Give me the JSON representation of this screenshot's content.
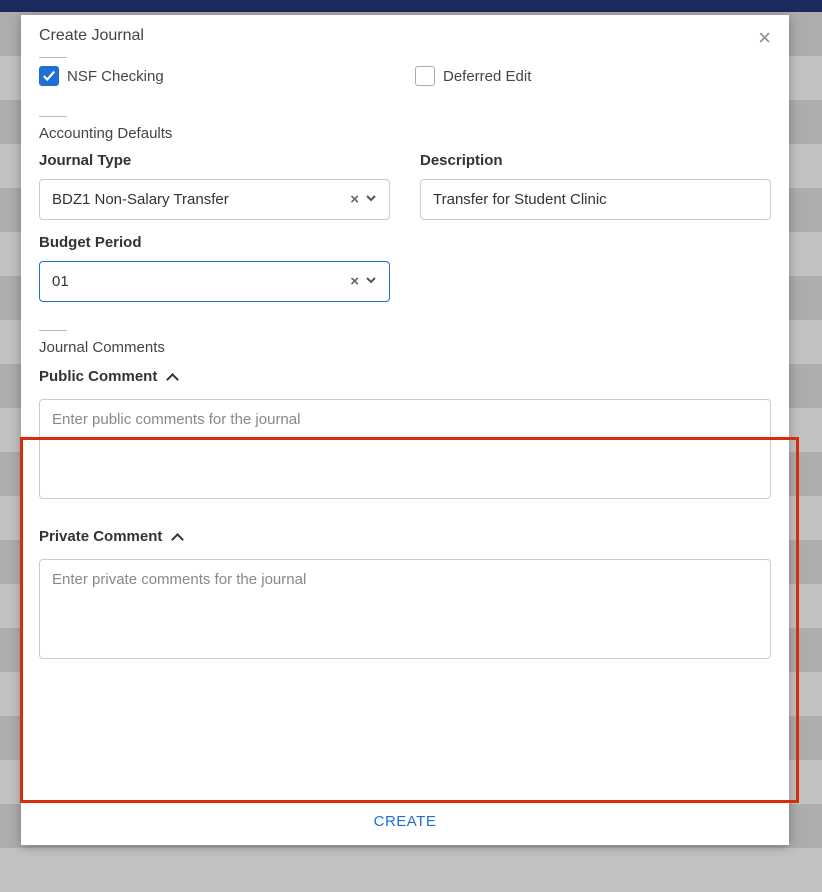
{
  "modal": {
    "title": "Create Journal",
    "checkboxes": {
      "nsf": {
        "label": "NSF Checking",
        "checked": true
      },
      "deferred": {
        "label": "Deferred Edit",
        "checked": false
      }
    },
    "accounting_defaults": {
      "heading": "Accounting Defaults",
      "journal_type": {
        "label": "Journal Type",
        "value": "BDZ1 Non-Salary Transfer"
      },
      "description": {
        "label": "Description",
        "value": "Transfer for Student Clinic"
      },
      "budget_period": {
        "label": "Budget Period",
        "value": "01"
      }
    },
    "journal_comments": {
      "heading": "Journal Comments",
      "public": {
        "label": "Public Comment",
        "placeholder": "Enter public comments for the journal",
        "value": ""
      },
      "private": {
        "label": "Private Comment",
        "placeholder": "Enter private comments for the journal",
        "value": ""
      }
    },
    "footer": {
      "create_label": "CREATE"
    }
  }
}
